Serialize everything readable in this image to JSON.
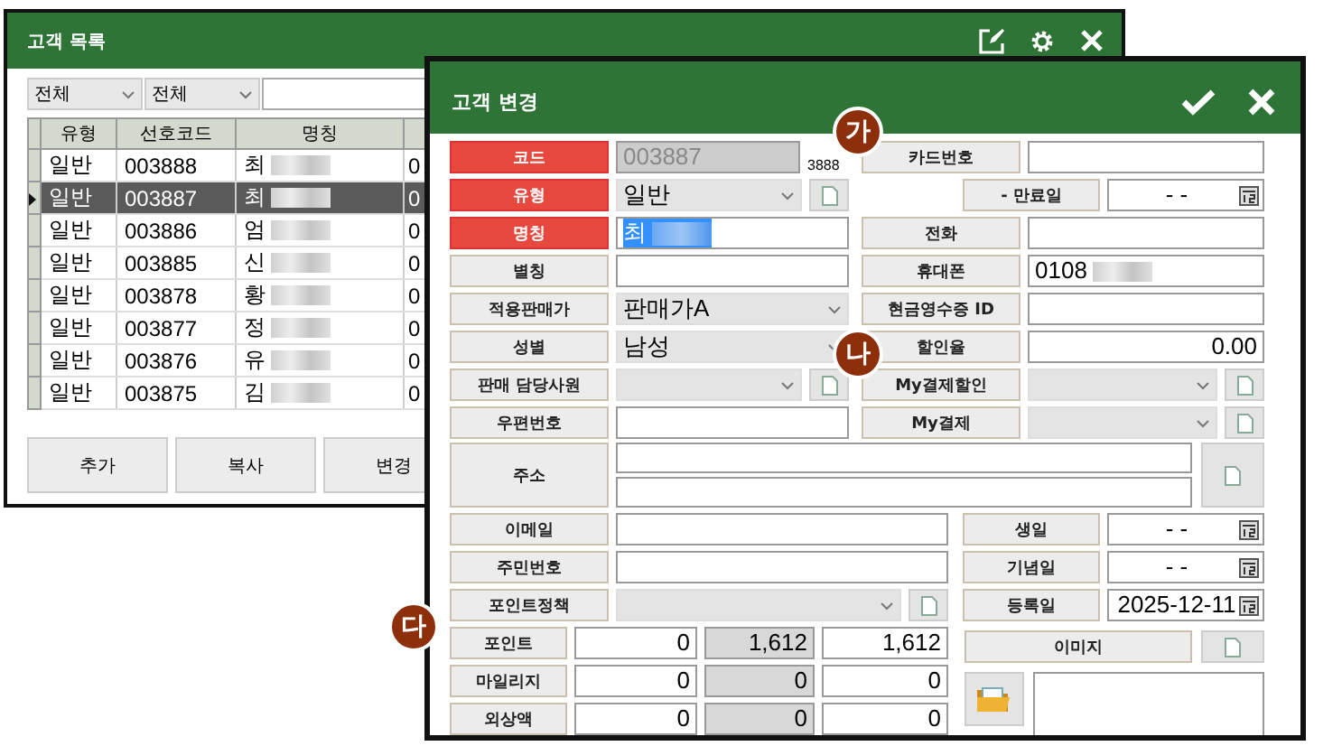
{
  "list_window": {
    "title": "고객 목록",
    "filters": [
      {
        "value": "전체"
      },
      {
        "value": "전체"
      }
    ],
    "columns": [
      "유형",
      "선호코드",
      "명칭"
    ],
    "rows": [
      {
        "type": "일반",
        "code": "003888",
        "name": "최",
        "column_4": "0",
        "redacted": true,
        "selected": false
      },
      {
        "type": "일반",
        "code": "003887",
        "name": "최",
        "column_4": "0",
        "redacted": true,
        "selected": true
      },
      {
        "type": "일반",
        "code": "003886",
        "name": "엄",
        "column_4": "0",
        "redacted": true,
        "selected": false
      },
      {
        "type": "일반",
        "code": "003885",
        "name": "신",
        "column_4": "0",
        "redacted": true,
        "selected": false
      },
      {
        "type": "일반",
        "code": "003878",
        "name": "황",
        "column_4": "0",
        "redacted": true,
        "selected": false
      },
      {
        "type": "일반",
        "code": "003877",
        "name": "정",
        "column_4": "0",
        "redacted": true,
        "selected": false
      },
      {
        "type": "일반",
        "code": "003876",
        "name": "유",
        "column_4": "0",
        "redacted": true,
        "selected": false
      },
      {
        "type": "일반",
        "code": "003875",
        "name": "김",
        "column_4": "0",
        "redacted": true,
        "selected": false
      }
    ],
    "buttons": [
      "추가",
      "복사",
      "변경"
    ]
  },
  "edit_dialog": {
    "title": "고객 변경",
    "top_left": [
      {
        "label": "코드",
        "kind": "readonly",
        "value": "003887",
        "required": true,
        "note": "3888"
      },
      {
        "label": "유형",
        "kind": "select",
        "value": "일반",
        "required": true,
        "doc": true
      },
      {
        "label": "명칭",
        "kind": "text",
        "value": "최",
        "required": true,
        "highlighted": true,
        "redacted": true
      },
      {
        "label": "별칭",
        "kind": "text",
        "required": false
      },
      {
        "label": "적용판매가",
        "kind": "select",
        "value": "판매가A",
        "required": false
      },
      {
        "label": "성별",
        "kind": "select",
        "value": "남성",
        "required": false
      },
      {
        "label": "판매 담당사원",
        "kind": "select",
        "required": false,
        "doc": true
      },
      {
        "label": "우편번호",
        "kind": "text",
        "required": false
      }
    ],
    "top_right": [
      {
        "label": "카드번호",
        "kind": "text",
        "required": false
      },
      {
        "label": "- 만료일",
        "kind": "date",
        "value": "-   -",
        "required": false
      },
      {
        "label": "전화",
        "kind": "text",
        "required": false
      },
      {
        "label": "휴대폰",
        "kind": "text",
        "value": "0108",
        "required": false,
        "redacted": true
      },
      {
        "label": "현금영수증 ID",
        "kind": "text",
        "required": false
      },
      {
        "label": "할인율",
        "kind": "number",
        "value": "0.00",
        "required": false
      },
      {
        "label": "My결제할인",
        "kind": "select",
        "required": false,
        "doc": true
      },
      {
        "label": "My결제",
        "kind": "select",
        "required": false,
        "doc": true
      }
    ],
    "address": {
      "label": "주소"
    },
    "lower_left": [
      {
        "label": "이메일",
        "kind": "text",
        "required": false
      },
      {
        "label": "주민번호",
        "kind": "text",
        "required": false
      },
      {
        "label": "포인트정책",
        "kind": "select",
        "required": false,
        "doc": true
      }
    ],
    "lower_right": [
      {
        "label": "생일",
        "kind": "date",
        "value": "-   -",
        "required": false
      },
      {
        "label": "기념일",
        "kind": "date",
        "value": "-   -",
        "required": false
      },
      {
        "label": "등록일",
        "kind": "date",
        "value": "2025-12-11",
        "required": false
      }
    ],
    "balances": [
      {
        "label": "포인트",
        "values": [
          "0",
          "1,612",
          "1,612"
        ]
      },
      {
        "label": "마일리지",
        "values": [
          "0",
          "0",
          "0"
        ]
      },
      {
        "label": "외상액",
        "values": [
          "0",
          "0",
          "0"
        ]
      }
    ],
    "image": {
      "label": "이미지"
    }
  },
  "badges": [
    {
      "label": "가"
    },
    {
      "label": "나"
    },
    {
      "label": "다"
    }
  ]
}
